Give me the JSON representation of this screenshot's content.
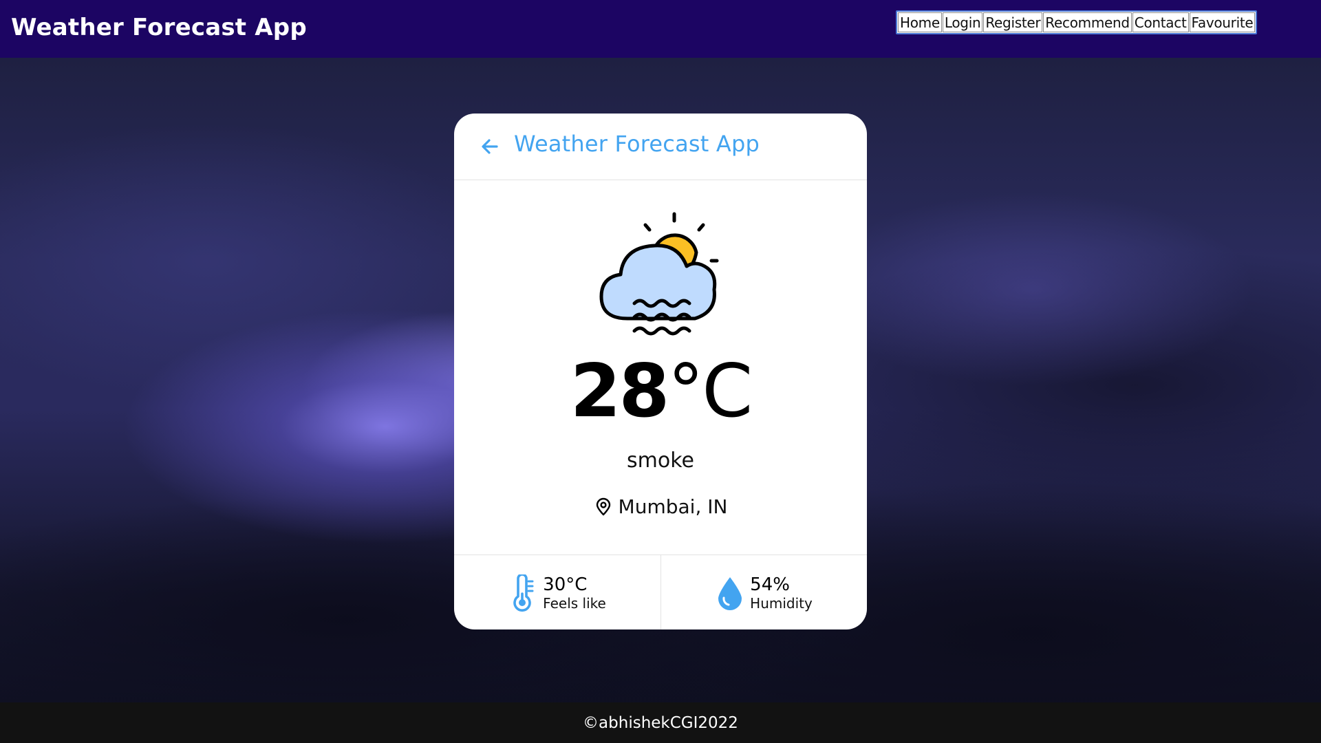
{
  "header": {
    "brand": "Weather Forecast App",
    "nav": [
      {
        "label": "Home"
      },
      {
        "label": "Login"
      },
      {
        "label": "Register"
      },
      {
        "label": "Recommend"
      },
      {
        "label": "Contact"
      },
      {
        "label": "Favourite"
      }
    ]
  },
  "card": {
    "title": "Weather Forecast App",
    "back_icon": "arrow-left-icon",
    "weather_icon": "cloud-sun-fog-icon",
    "temperature": {
      "value": "28",
      "unit": "°C"
    },
    "condition": "smoke",
    "location": "Mumbai, IN",
    "location_icon": "map-pin-icon",
    "stats": [
      {
        "value": "30°C",
        "label": "Feels like",
        "icon": "thermometer-icon"
      },
      {
        "value": "54%",
        "label": "Humidity",
        "icon": "water-drop-icon"
      }
    ]
  },
  "footer": {
    "text": "©abhishekCGI2022"
  },
  "colors": {
    "header_bg": "#1c0563",
    "accent": "#43a4f0",
    "footer_bg": "#121212",
    "card_bg": "#ffffff"
  }
}
